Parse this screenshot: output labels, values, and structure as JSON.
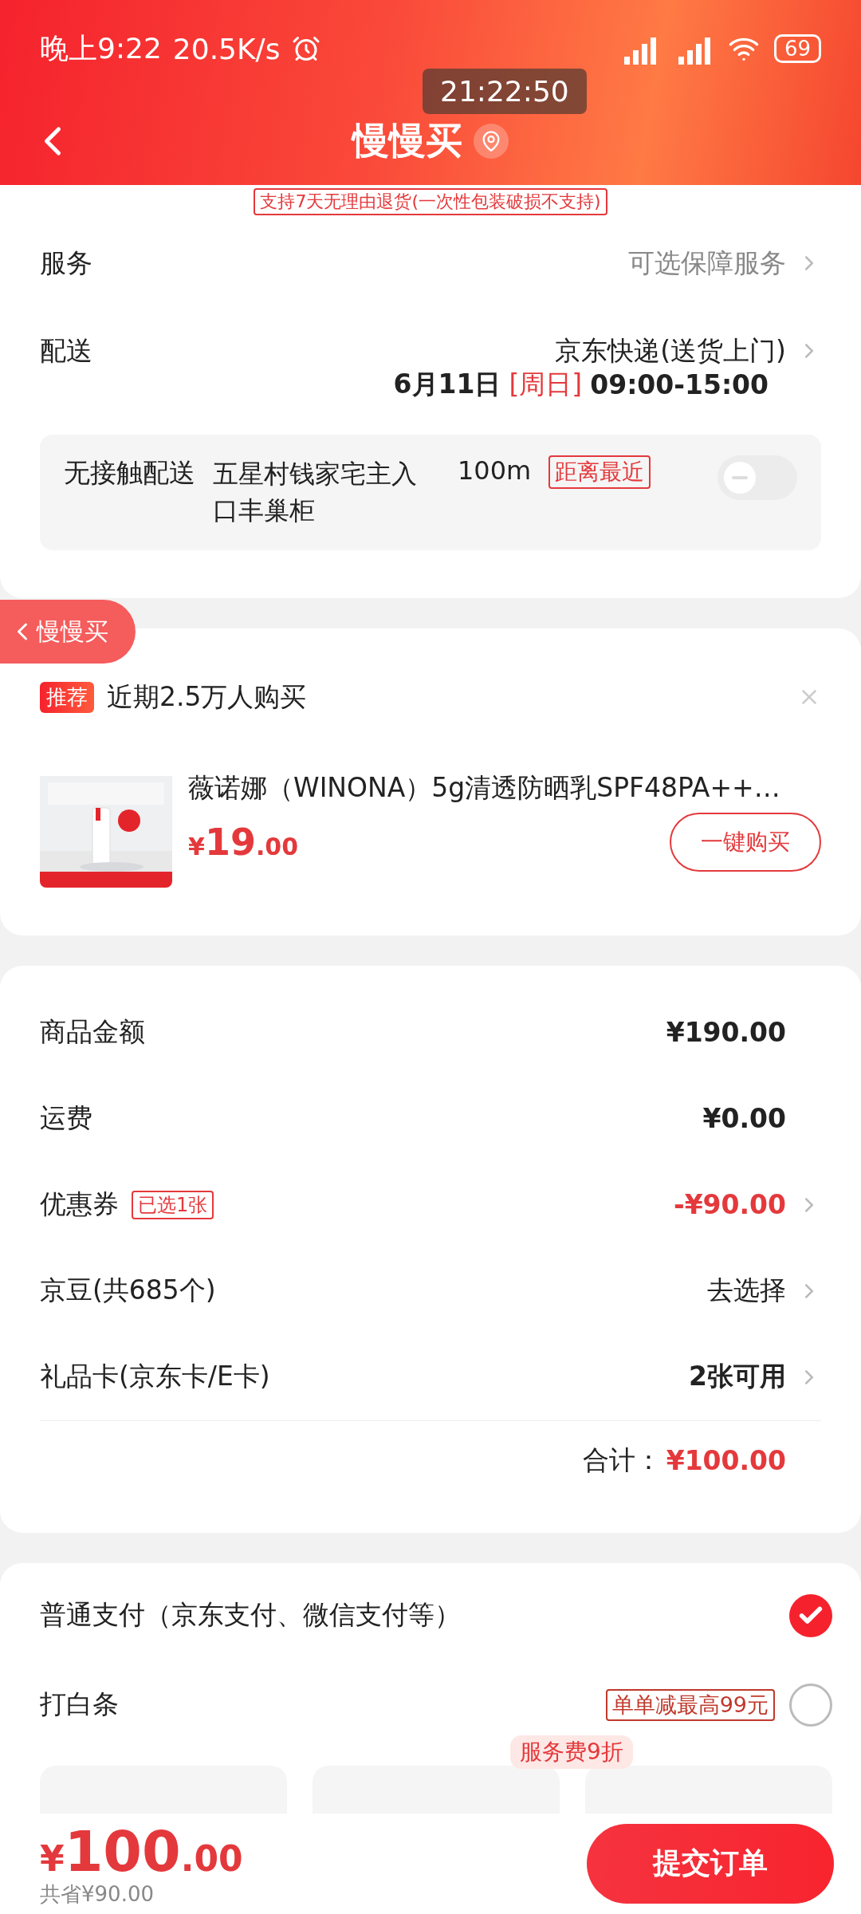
{
  "status_bar": {
    "time": "晚上9:22",
    "speed": "20.5K/s",
    "battery": "69"
  },
  "time_overlay": "21:22:50",
  "header": {
    "title": "慢慢买"
  },
  "return_tag": "支持7天无理由退货(一次性包装破损不支持)",
  "service": {
    "label": "服务",
    "value": "可选保障服务"
  },
  "delivery": {
    "label": "配送",
    "value": "京东快递(送货上门)",
    "date": "6月11日",
    "weekday": "[周日]",
    "time": "09:00-15:00"
  },
  "contactless": {
    "label": "无接触配送",
    "location": "五星村钱家宅主入口丰巢柜",
    "distance": "100m",
    "tag": "距离最近",
    "on": false
  },
  "back_pill": "慢慢买",
  "recommend": {
    "badge": "推荐",
    "title": "近期2.5万人购买",
    "product": {
      "name": "薇诺娜（WINONA）5g清透防晒乳SPF48PA++…",
      "currency": "¥",
      "price_int": "19",
      "price_dec": ".00",
      "button": "一键购买"
    }
  },
  "summary": {
    "rows": [
      {
        "label": "商品金额",
        "value": "¥190.00",
        "kind": "plain"
      },
      {
        "label": "运费",
        "value": "¥0.00",
        "kind": "plain"
      },
      {
        "label": "优惠券",
        "tag": "已选1张",
        "value": "-¥90.00",
        "kind": "discount"
      },
      {
        "label": "京豆(共685个)",
        "value": "去选择",
        "kind": "link"
      },
      {
        "label": "礼品卡(京东卡/E卡)",
        "value": "2张可用",
        "kind": "link"
      }
    ],
    "total_label": "合计：",
    "total": "¥100.00"
  },
  "payment": {
    "options": [
      {
        "label": "普通支付（京东支付、微信支付等）",
        "selected": true
      },
      {
        "label": "打白条",
        "tag": "单单减最高99元",
        "selected": false
      }
    ],
    "fee_tag": "服务费9折"
  },
  "bottom": {
    "currency": "¥",
    "amount_int": "100",
    "amount_dec": ".00",
    "saved": "共省¥90.00",
    "submit": "提交订单"
  }
}
